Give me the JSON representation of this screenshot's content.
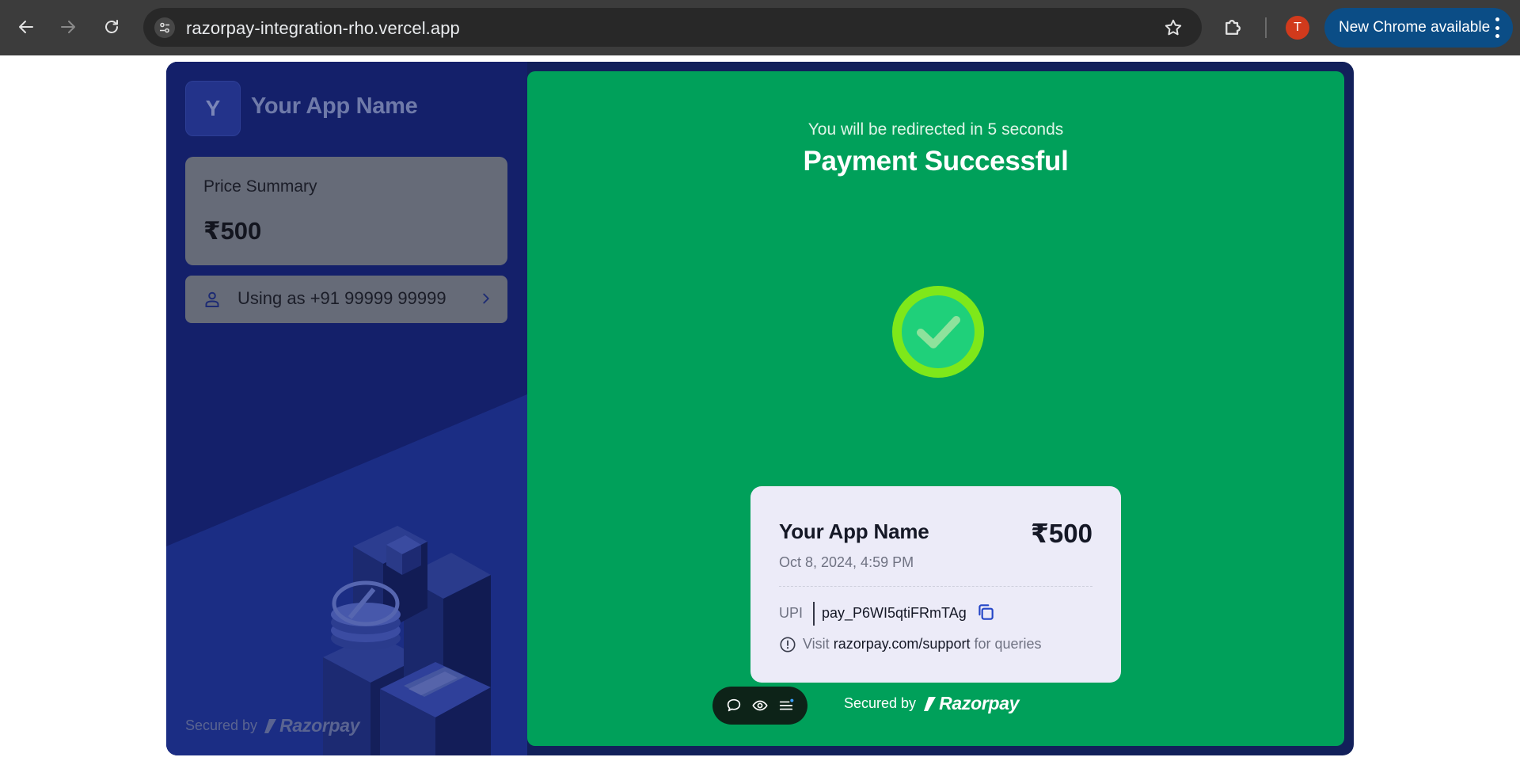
{
  "browser": {
    "url": "razorpay-integration-rho.vercel.app",
    "profile_initial": "T",
    "update_label": "New Chrome available",
    "icons": {
      "back": "arrow-left-icon",
      "forward": "arrow-right-icon",
      "reload": "reload-icon",
      "site_info": "tune-icon",
      "bookmark": "star-icon",
      "extensions": "puzzle-icon",
      "menu": "kebab-icon"
    }
  },
  "checkout": {
    "merchant_initial": "Y",
    "merchant_name": "Your App Name",
    "price_summary": {
      "label": "Price Summary",
      "amount": "₹500"
    },
    "user": {
      "label": "Using as +91 99999 99999"
    },
    "secured_by": "Secured by",
    "brand": "Razorpay",
    "status": {
      "redirect_text": "You will be redirected in 5 seconds",
      "title": "Payment Successful"
    },
    "receipt": {
      "app_name": "Your App Name",
      "amount": "₹500",
      "date": "Oct 8, 2024, 4:59 PM",
      "method": "UPI",
      "payment_id": "pay_P6WI5qtiFRmTAg",
      "support_prefix": "Visit",
      "support_link": "razorpay.com/support",
      "support_suffix": "for queries"
    }
  },
  "colors": {
    "chrome_bg": "#3c3c3c",
    "frame_bg": "#12205a",
    "left_panel": "#1a2a7a",
    "success_green": "#00a05a",
    "check_ring": "#7ee81a",
    "check_fill": "#1fd07a",
    "receipt_bg": "#ecebf8",
    "update_pill": "#0b4d86"
  }
}
